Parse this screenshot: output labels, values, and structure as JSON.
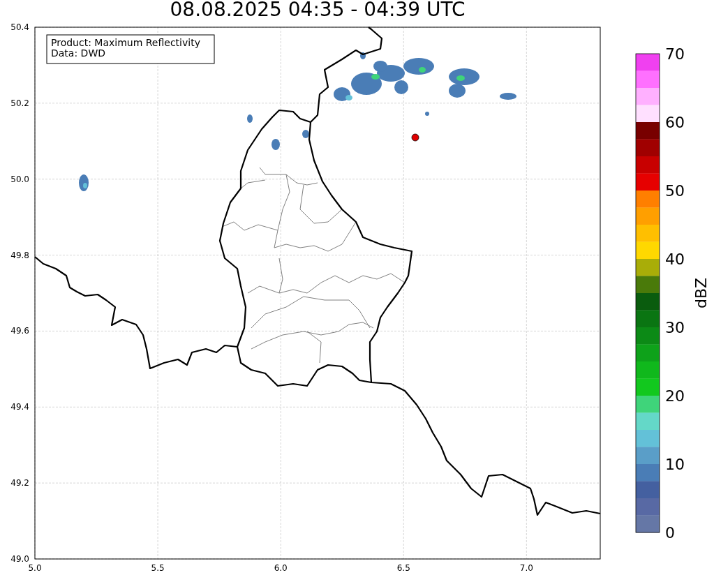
{
  "title": "08.08.2025 04:35 - 04:39 UTC",
  "map": {
    "legend": [
      "Product: Maximum Reflectivity",
      "Data: DWD"
    ],
    "x_ticks": [
      "5.0",
      "5.5",
      "6.0",
      "6.5",
      "7.0"
    ],
    "y_ticks": [
      "50.4",
      "50.2",
      "50.0",
      "49.8",
      "49.6",
      "49.4",
      "49.2",
      "49.0"
    ]
  },
  "colorbar": {
    "label": "dBZ",
    "ticks": [
      "70",
      "60",
      "50",
      "40",
      "30",
      "20",
      "10",
      "0"
    ],
    "bands": [
      {
        "color": "#f040f0"
      },
      {
        "color": "#ff70ff"
      },
      {
        "color": "#ffb0ff"
      },
      {
        "color": "#ffe0ff"
      },
      {
        "color": "#780000"
      },
      {
        "color": "#a00000"
      },
      {
        "color": "#c80000"
      },
      {
        "color": "#e60000"
      },
      {
        "color": "#ff7f00"
      },
      {
        "color": "#ff9f00"
      },
      {
        "color": "#ffbf00"
      },
      {
        "color": "#ffd800"
      },
      {
        "color": "#a9ad08"
      },
      {
        "color": "#4a7a0a"
      },
      {
        "color": "#0a5c0e"
      },
      {
        "color": "#0a7512"
      },
      {
        "color": "#0c8a16"
      },
      {
        "color": "#0ea21a"
      },
      {
        "color": "#10b81c"
      },
      {
        "color": "#12c81e"
      },
      {
        "color": "#3fd47a"
      },
      {
        "color": "#64d8c8"
      },
      {
        "color": "#63c1d8"
      },
      {
        "color": "#5a9ec8"
      },
      {
        "color": "#4a7db6"
      },
      {
        "color": "#4460a0"
      },
      {
        "color": "#5869a4"
      },
      {
        "color": "#6577a6"
      }
    ]
  }
}
